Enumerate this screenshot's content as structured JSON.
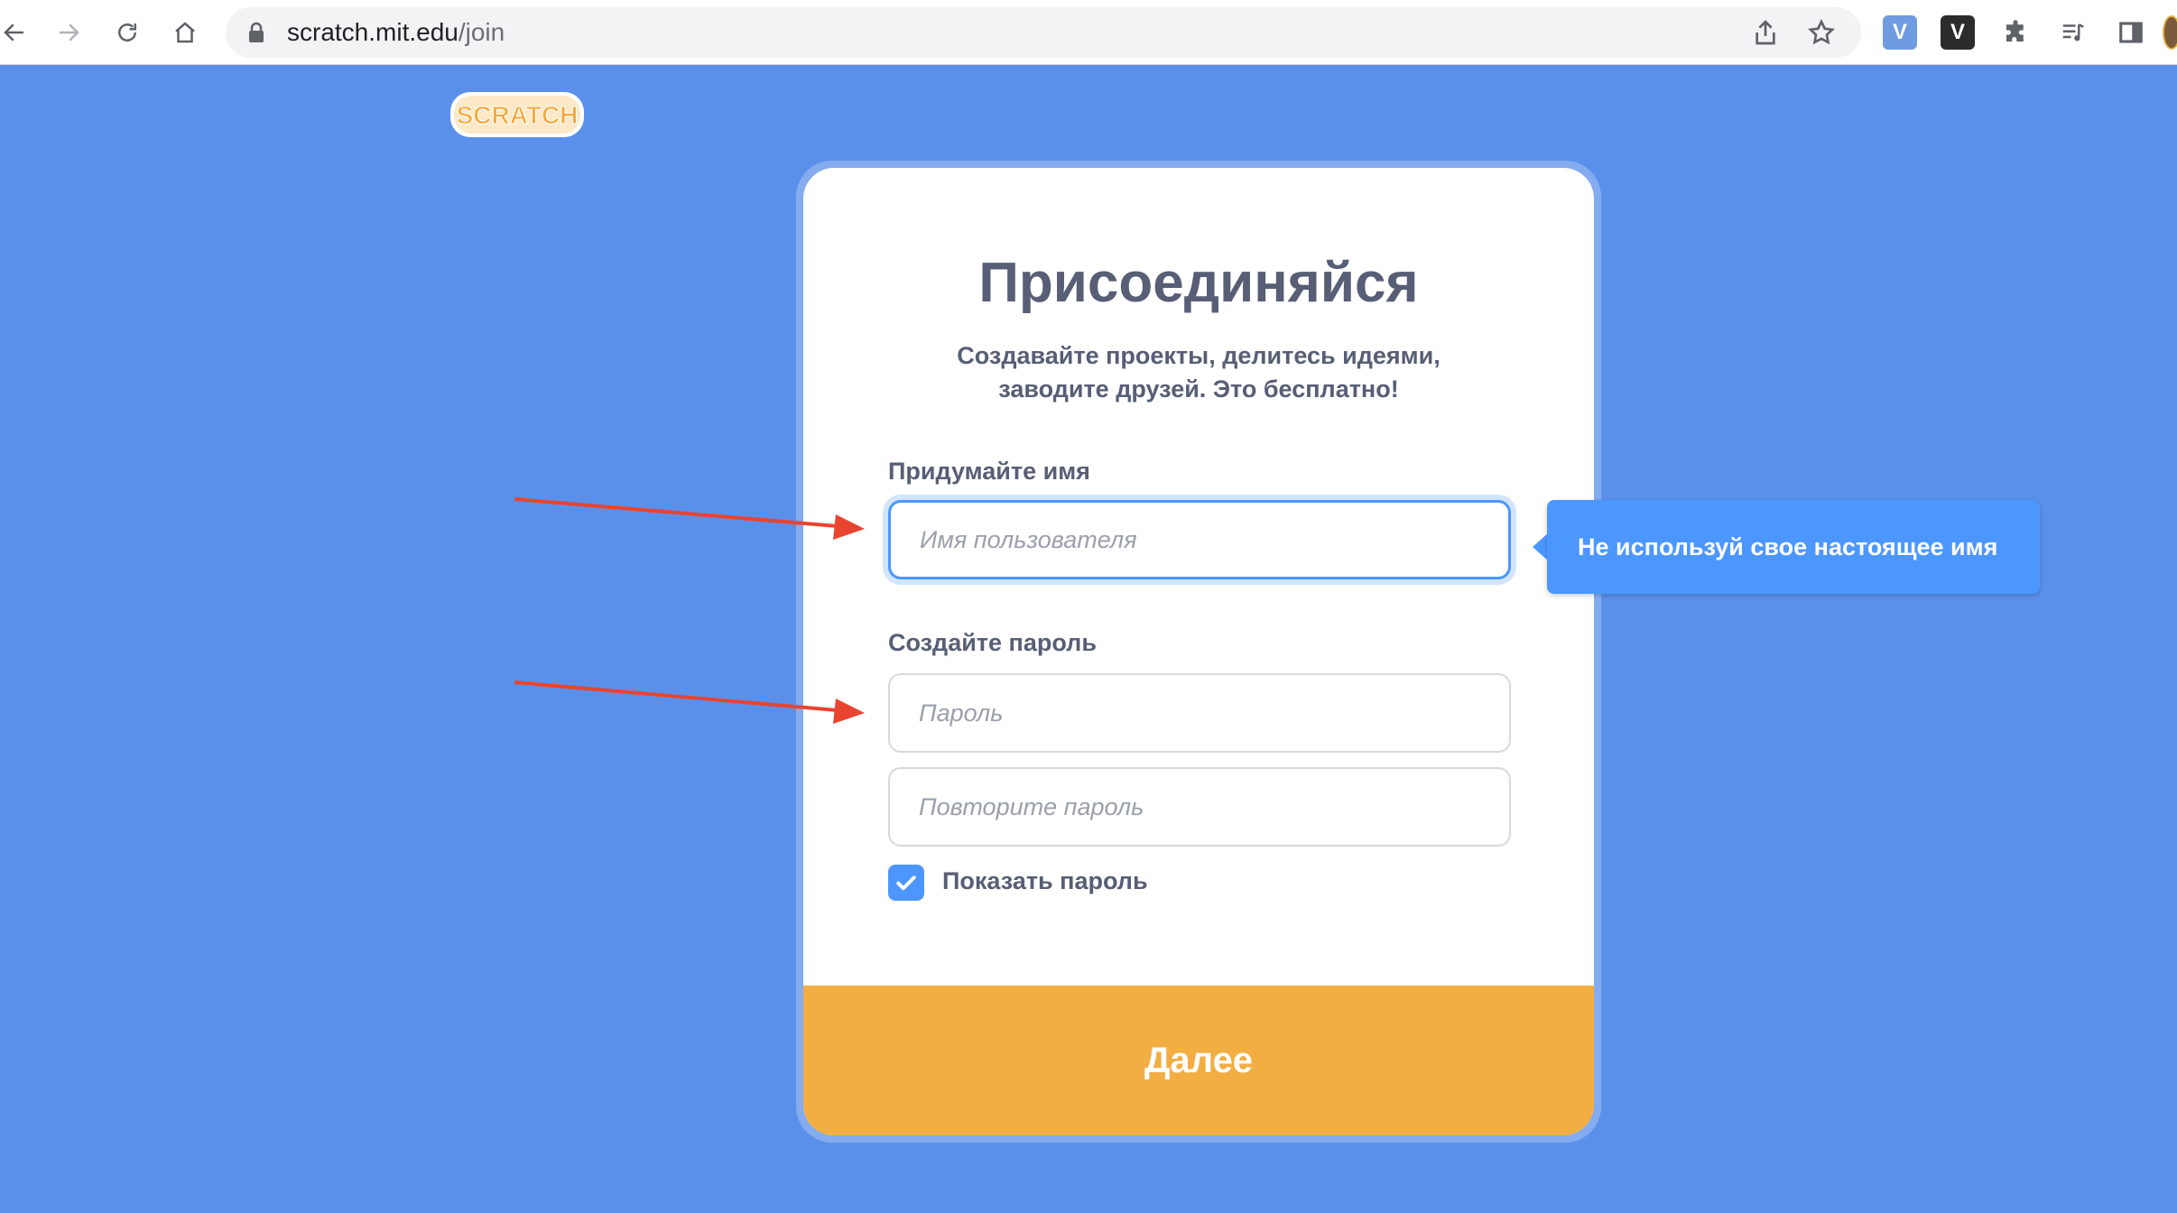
{
  "browser": {
    "url_host": "scratch.mit.edu",
    "url_path": "/join"
  },
  "page": {
    "title": "Присоединяйся",
    "subtitle_line1": "Создавайте проекты, делитесь идеями,",
    "subtitle_line2": "заводите друзей. Это бесплатно!",
    "username_label": "Придумайте имя",
    "username_placeholder": "Имя пользователя",
    "password_label": "Создайте пароль",
    "password_placeholder": "Пароль",
    "password_repeat_placeholder": "Повторите пароль",
    "show_password_label": "Показать пароль",
    "show_password_checked": true,
    "next_button": "Далее",
    "tooltip": "Не используй свое настоящее имя"
  },
  "logo": {
    "text": "SCRATCH"
  },
  "extensions": [
    "V",
    "V"
  ],
  "colors": {
    "background": "#5b90ea",
    "accent": "#4c97ff",
    "button": "#f2ae42",
    "text": "#575e75",
    "annotation_arrow": "#e8442f"
  }
}
